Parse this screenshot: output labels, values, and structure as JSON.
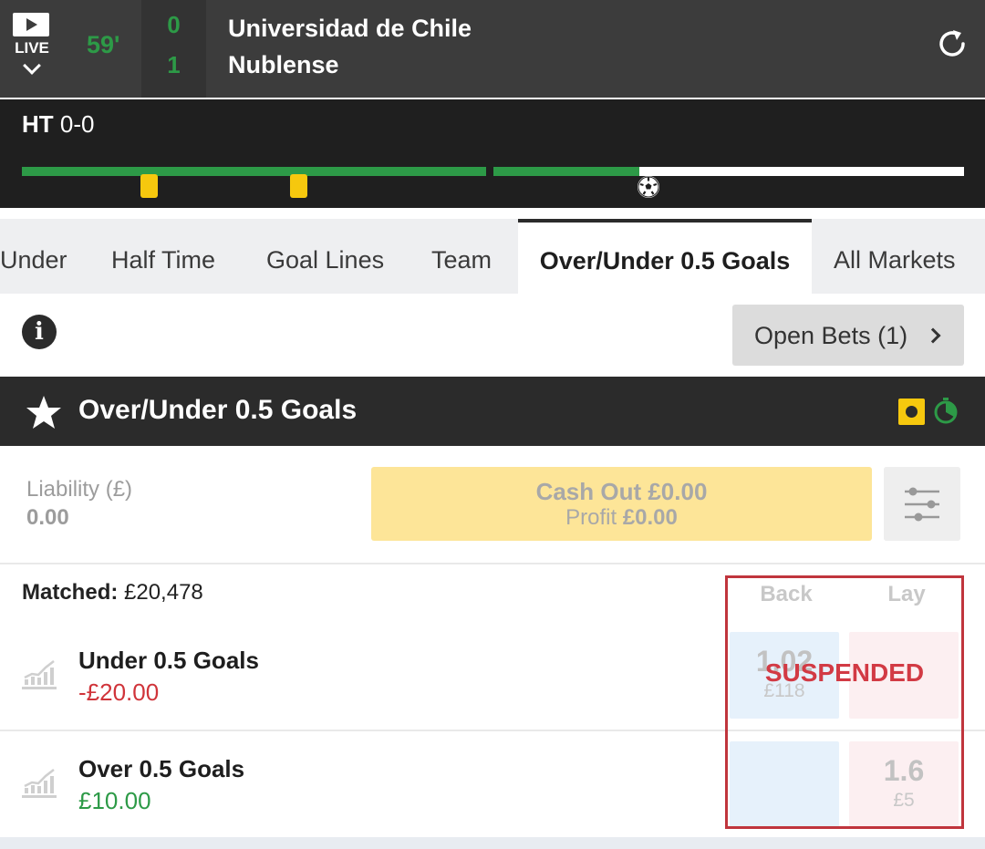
{
  "scoreboard": {
    "live_label": "LIVE",
    "match_time": "59'",
    "home_score": "0",
    "away_score": "1",
    "home_team": "Universidad de Chile",
    "away_team": "Nublense"
  },
  "timeline": {
    "ht_label": "HT",
    "ht_score": "0-0",
    "progress_fraction": 0.66
  },
  "tabs": [
    {
      "label": "Under"
    },
    {
      "label": "Half Time"
    },
    {
      "label": "Goal Lines"
    },
    {
      "label": "Team"
    },
    {
      "label": "Over/Under 0.5 Goals",
      "active": true
    },
    {
      "label": "All Markets"
    }
  ],
  "open_bets": {
    "label": "Open Bets (1)"
  },
  "market": {
    "title": "Over/Under 0.5 Goals"
  },
  "cashout": {
    "liability_label": "Liability (£)",
    "liability_value": "0.00",
    "cash_out_label": "Cash Out £0.00",
    "profit_prefix": "Profit",
    "profit_value": "£0.00"
  },
  "runners_table": {
    "matched_label": "Matched:",
    "matched_value": "£20,478",
    "back_header": "Back",
    "lay_header": "Lay",
    "status": "SUSPENDED",
    "runners": [
      {
        "name": "Under 0.5 Goals",
        "pl": "-£20.00",
        "back_price": "1.02",
        "back_size": "£118",
        "lay_price": "",
        "lay_size": ""
      },
      {
        "name": "Over 0.5 Goals",
        "pl": "£10.00",
        "back_price": "",
        "back_size": "",
        "lay_price": "1.6",
        "lay_size": "£5"
      }
    ]
  },
  "colors": {
    "green": "#2d9a47",
    "card_yellow": "#f6c80e",
    "suspended_red": "#d23a44",
    "cashout_yellow": "#fde598"
  },
  "icons": [
    "play-icon",
    "chevron-down-icon",
    "refresh-icon",
    "yellow-card-icon",
    "football-icon",
    "info-icon",
    "chevron-right-icon",
    "star-icon",
    "in-play-icon",
    "clock-icon",
    "settings-sliders-icon",
    "chart-icon"
  ]
}
